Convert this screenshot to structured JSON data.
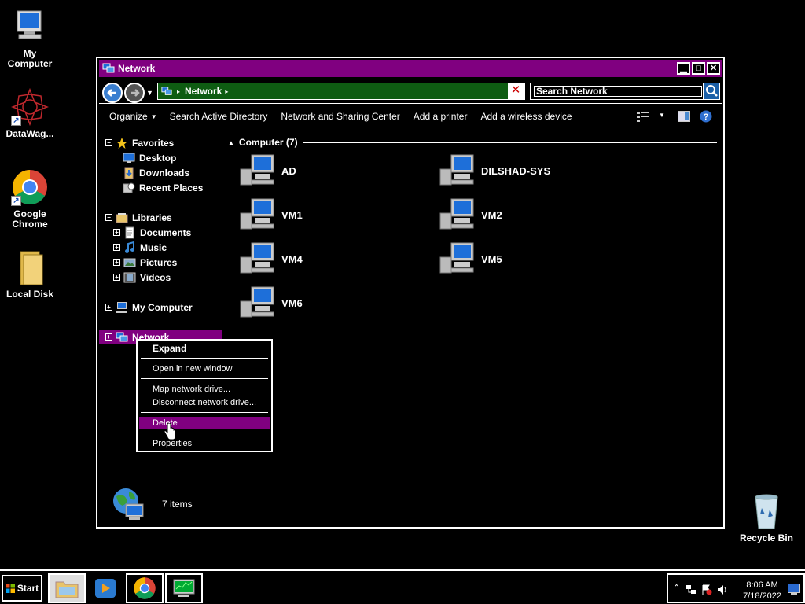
{
  "desktop": {
    "icons": [
      {
        "label": "My Computer"
      },
      {
        "label": "DataWag..."
      },
      {
        "label": "Google Chrome"
      },
      {
        "label": "Local Disk"
      },
      {
        "label": "Recycle Bin"
      }
    ]
  },
  "window": {
    "title": "Network",
    "address": {
      "crumb": "Network"
    },
    "search": {
      "value": "Search Network"
    },
    "toolbar": [
      "Organize",
      "Search Active Directory",
      "Network and Sharing Center",
      "Add a printer",
      "Add a wireless device"
    ]
  },
  "nav": {
    "favorites": "Favorites",
    "desktop": "Desktop",
    "downloads": "Downloads",
    "recent": "Recent Places",
    "libraries": "Libraries",
    "documents": "Documents",
    "music": "Music",
    "pictures": "Pictures",
    "videos": "Videos",
    "my_computer": "My Computer",
    "network": "Network"
  },
  "content": {
    "group_label": "Computer (7)",
    "computers": [
      "AD",
      "DILSHAD-SYS",
      "VM1",
      "VM2",
      "VM4",
      "VM5",
      "VM6"
    ],
    "item_count": "7 items"
  },
  "context_menu": {
    "expand": "Expand",
    "open_new": "Open in new window",
    "map_drive": "Map network drive...",
    "disconnect": "Disconnect network drive...",
    "delete": "Delete",
    "properties": "Properties"
  },
  "taskbar": {
    "start": "Start",
    "time": "8:06 AM",
    "date": "7/18/2022"
  },
  "colors": {
    "accent": "#800080",
    "address_bg": "#0e5c12",
    "background": "#000000"
  }
}
